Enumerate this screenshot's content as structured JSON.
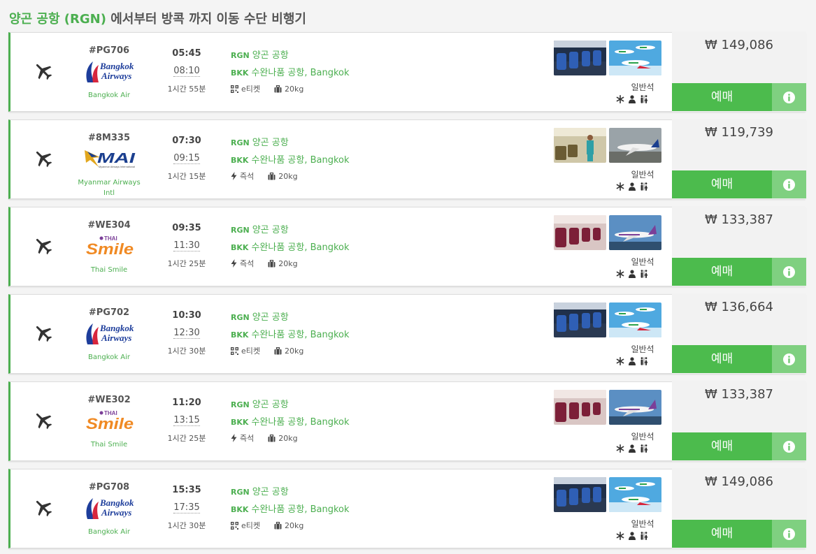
{
  "header": {
    "prefix": "양곤 공항 (RGN)",
    "suffix": " 에서부터 방콕 까지 이동 수단 비행기"
  },
  "colors": {
    "accent": "#4caf50",
    "book_button": "#4cbb4d",
    "info_button": "#7fd080"
  },
  "flights": [
    {
      "flight_no": "#PG706",
      "airline": "Bangkok Air",
      "logo": "bangkok-airways-logo",
      "depart": "05:45",
      "arrive": "08:10",
      "duration": "1시간 55분",
      "from_code": "RGN",
      "from_name": "양곤 공항",
      "to_code": "BKK",
      "to_name": "수완나품 공항, Bangkok",
      "ticket_icon": "qr-code-icon",
      "ticket": "e티켓",
      "baggage": "20kg",
      "cabin": "일반석",
      "price": "₩ 149,086",
      "book": "예매"
    },
    {
      "flight_no": "#8M335",
      "airline": "Myanmar Airways Intl",
      "logo": "mai-logo",
      "depart": "07:30",
      "arrive": "09:15",
      "duration": "1시간 15분",
      "from_code": "RGN",
      "from_name": "양곤 공항",
      "to_code": "BKK",
      "to_name": "수완나품 공항, Bangkok",
      "ticket_icon": "bolt-icon",
      "ticket": "즉석",
      "baggage": "20kg",
      "cabin": "일반석",
      "price": "₩ 119,739",
      "book": "예매"
    },
    {
      "flight_no": "#WE304",
      "airline": "Thai Smile",
      "logo": "thai-smile-logo",
      "depart": "09:35",
      "arrive": "11:30",
      "duration": "1시간 25분",
      "from_code": "RGN",
      "from_name": "양곤 공항",
      "to_code": "BKK",
      "to_name": "수완나품 공항, Bangkok",
      "ticket_icon": "bolt-icon",
      "ticket": "즉석",
      "baggage": "20kg",
      "cabin": "일반석",
      "price": "₩ 133,387",
      "book": "예매"
    },
    {
      "flight_no": "#PG702",
      "airline": "Bangkok Air",
      "logo": "bangkok-airways-logo",
      "depart": "10:30",
      "arrive": "12:30",
      "duration": "1시간 30분",
      "from_code": "RGN",
      "from_name": "양곤 공항",
      "to_code": "BKK",
      "to_name": "수완나품 공항, Bangkok",
      "ticket_icon": "qr-code-icon",
      "ticket": "e티켓",
      "baggage": "20kg",
      "cabin": "일반석",
      "price": "₩ 136,664",
      "book": "예매"
    },
    {
      "flight_no": "#WE302",
      "airline": "Thai Smile",
      "logo": "thai-smile-logo",
      "depart": "11:20",
      "arrive": "13:15",
      "duration": "1시간 25분",
      "from_code": "RGN",
      "from_name": "양곤 공항",
      "to_code": "BKK",
      "to_name": "수완나품 공항, Bangkok",
      "ticket_icon": "bolt-icon",
      "ticket": "즉석",
      "baggage": "20kg",
      "cabin": "일반석",
      "price": "₩ 133,387",
      "book": "예매"
    },
    {
      "flight_no": "#PG708",
      "airline": "Bangkok Air",
      "logo": "bangkok-airways-logo",
      "depart": "15:35",
      "arrive": "17:35",
      "duration": "1시간 30분",
      "from_code": "RGN",
      "from_name": "양곤 공항",
      "to_code": "BKK",
      "to_name": "수완나품 공항, Bangkok",
      "ticket_icon": "qr-code-icon",
      "ticket": "e티켓",
      "baggage": "20kg",
      "cabin": "일반석",
      "price": "₩ 149,086",
      "book": "예매"
    }
  ],
  "logo_text": {
    "bangkok-airways-logo": [
      "Bangkok",
      "Airways"
    ],
    "mai-logo": [
      "MAI",
      "Myanmar Airways International"
    ],
    "thai-smile-logo": [
      "Smile",
      "THAI"
    ]
  }
}
